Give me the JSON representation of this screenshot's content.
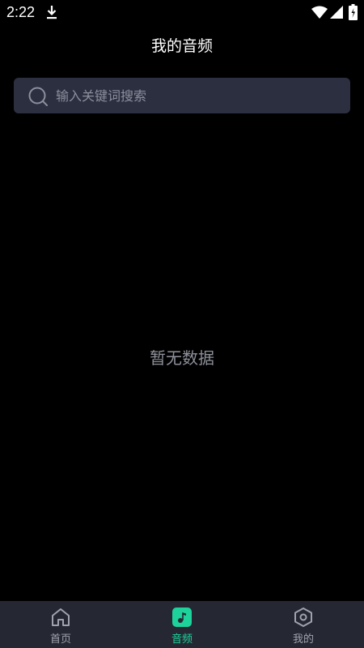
{
  "status_bar": {
    "time": "2:22"
  },
  "header": {
    "title": "我的音频"
  },
  "search": {
    "placeholder": "输入关键词搜索",
    "value": ""
  },
  "main": {
    "empty_text": "暂无数据"
  },
  "bottom_nav": {
    "items": [
      {
        "label": "首页",
        "icon": "home-icon",
        "active": false
      },
      {
        "label": "音频",
        "icon": "music-note-icon",
        "active": true
      },
      {
        "label": "我的",
        "icon": "hexagon-settings-icon",
        "active": false
      }
    ]
  },
  "colors": {
    "background": "#000000",
    "search_bg": "#2c2f40",
    "nav_bg": "#252833",
    "accent": "#1dd29b",
    "muted_text": "#8e919a"
  }
}
